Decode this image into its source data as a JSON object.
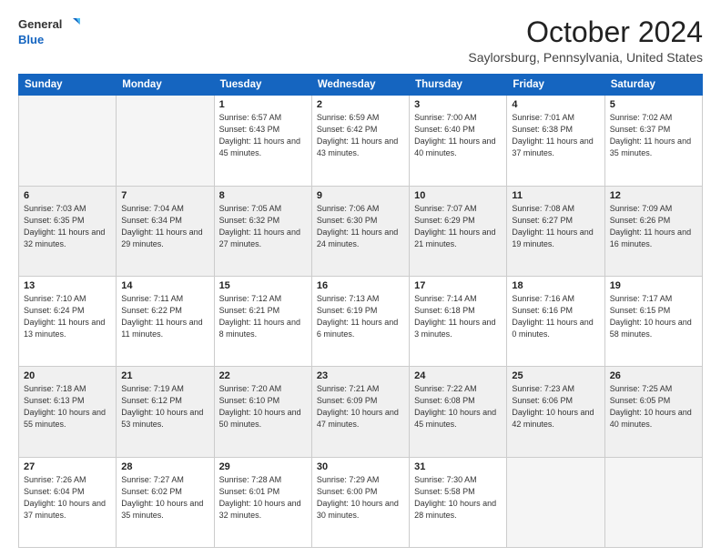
{
  "header": {
    "logo": {
      "line1": "General",
      "line2": "Blue"
    },
    "title": "October 2024",
    "location": "Saylorsburg, Pennsylvania, United States"
  },
  "weekdays": [
    "Sunday",
    "Monday",
    "Tuesday",
    "Wednesday",
    "Thursday",
    "Friday",
    "Saturday"
  ],
  "weeks": [
    [
      {
        "day": "",
        "empty": true
      },
      {
        "day": "",
        "empty": true
      },
      {
        "day": "1",
        "sunrise": "Sunrise: 6:57 AM",
        "sunset": "Sunset: 6:43 PM",
        "daylight": "Daylight: 11 hours and 45 minutes."
      },
      {
        "day": "2",
        "sunrise": "Sunrise: 6:59 AM",
        "sunset": "Sunset: 6:42 PM",
        "daylight": "Daylight: 11 hours and 43 minutes."
      },
      {
        "day": "3",
        "sunrise": "Sunrise: 7:00 AM",
        "sunset": "Sunset: 6:40 PM",
        "daylight": "Daylight: 11 hours and 40 minutes."
      },
      {
        "day": "4",
        "sunrise": "Sunrise: 7:01 AM",
        "sunset": "Sunset: 6:38 PM",
        "daylight": "Daylight: 11 hours and 37 minutes."
      },
      {
        "day": "5",
        "sunrise": "Sunrise: 7:02 AM",
        "sunset": "Sunset: 6:37 PM",
        "daylight": "Daylight: 11 hours and 35 minutes."
      }
    ],
    [
      {
        "day": "6",
        "sunrise": "Sunrise: 7:03 AM",
        "sunset": "Sunset: 6:35 PM",
        "daylight": "Daylight: 11 hours and 32 minutes."
      },
      {
        "day": "7",
        "sunrise": "Sunrise: 7:04 AM",
        "sunset": "Sunset: 6:34 PM",
        "daylight": "Daylight: 11 hours and 29 minutes."
      },
      {
        "day": "8",
        "sunrise": "Sunrise: 7:05 AM",
        "sunset": "Sunset: 6:32 PM",
        "daylight": "Daylight: 11 hours and 27 minutes."
      },
      {
        "day": "9",
        "sunrise": "Sunrise: 7:06 AM",
        "sunset": "Sunset: 6:30 PM",
        "daylight": "Daylight: 11 hours and 24 minutes."
      },
      {
        "day": "10",
        "sunrise": "Sunrise: 7:07 AM",
        "sunset": "Sunset: 6:29 PM",
        "daylight": "Daylight: 11 hours and 21 minutes."
      },
      {
        "day": "11",
        "sunrise": "Sunrise: 7:08 AM",
        "sunset": "Sunset: 6:27 PM",
        "daylight": "Daylight: 11 hours and 19 minutes."
      },
      {
        "day": "12",
        "sunrise": "Sunrise: 7:09 AM",
        "sunset": "Sunset: 6:26 PM",
        "daylight": "Daylight: 11 hours and 16 minutes."
      }
    ],
    [
      {
        "day": "13",
        "sunrise": "Sunrise: 7:10 AM",
        "sunset": "Sunset: 6:24 PM",
        "daylight": "Daylight: 11 hours and 13 minutes."
      },
      {
        "day": "14",
        "sunrise": "Sunrise: 7:11 AM",
        "sunset": "Sunset: 6:22 PM",
        "daylight": "Daylight: 11 hours and 11 minutes."
      },
      {
        "day": "15",
        "sunrise": "Sunrise: 7:12 AM",
        "sunset": "Sunset: 6:21 PM",
        "daylight": "Daylight: 11 hours and 8 minutes."
      },
      {
        "day": "16",
        "sunrise": "Sunrise: 7:13 AM",
        "sunset": "Sunset: 6:19 PM",
        "daylight": "Daylight: 11 hours and 6 minutes."
      },
      {
        "day": "17",
        "sunrise": "Sunrise: 7:14 AM",
        "sunset": "Sunset: 6:18 PM",
        "daylight": "Daylight: 11 hours and 3 minutes."
      },
      {
        "day": "18",
        "sunrise": "Sunrise: 7:16 AM",
        "sunset": "Sunset: 6:16 PM",
        "daylight": "Daylight: 11 hours and 0 minutes."
      },
      {
        "day": "19",
        "sunrise": "Sunrise: 7:17 AM",
        "sunset": "Sunset: 6:15 PM",
        "daylight": "Daylight: 10 hours and 58 minutes."
      }
    ],
    [
      {
        "day": "20",
        "sunrise": "Sunrise: 7:18 AM",
        "sunset": "Sunset: 6:13 PM",
        "daylight": "Daylight: 10 hours and 55 minutes."
      },
      {
        "day": "21",
        "sunrise": "Sunrise: 7:19 AM",
        "sunset": "Sunset: 6:12 PM",
        "daylight": "Daylight: 10 hours and 53 minutes."
      },
      {
        "day": "22",
        "sunrise": "Sunrise: 7:20 AM",
        "sunset": "Sunset: 6:10 PM",
        "daylight": "Daylight: 10 hours and 50 minutes."
      },
      {
        "day": "23",
        "sunrise": "Sunrise: 7:21 AM",
        "sunset": "Sunset: 6:09 PM",
        "daylight": "Daylight: 10 hours and 47 minutes."
      },
      {
        "day": "24",
        "sunrise": "Sunrise: 7:22 AM",
        "sunset": "Sunset: 6:08 PM",
        "daylight": "Daylight: 10 hours and 45 minutes."
      },
      {
        "day": "25",
        "sunrise": "Sunrise: 7:23 AM",
        "sunset": "Sunset: 6:06 PM",
        "daylight": "Daylight: 10 hours and 42 minutes."
      },
      {
        "day": "26",
        "sunrise": "Sunrise: 7:25 AM",
        "sunset": "Sunset: 6:05 PM",
        "daylight": "Daylight: 10 hours and 40 minutes."
      }
    ],
    [
      {
        "day": "27",
        "sunrise": "Sunrise: 7:26 AM",
        "sunset": "Sunset: 6:04 PM",
        "daylight": "Daylight: 10 hours and 37 minutes."
      },
      {
        "day": "28",
        "sunrise": "Sunrise: 7:27 AM",
        "sunset": "Sunset: 6:02 PM",
        "daylight": "Daylight: 10 hours and 35 minutes."
      },
      {
        "day": "29",
        "sunrise": "Sunrise: 7:28 AM",
        "sunset": "Sunset: 6:01 PM",
        "daylight": "Daylight: 10 hours and 32 minutes."
      },
      {
        "day": "30",
        "sunrise": "Sunrise: 7:29 AM",
        "sunset": "Sunset: 6:00 PM",
        "daylight": "Daylight: 10 hours and 30 minutes."
      },
      {
        "day": "31",
        "sunrise": "Sunrise: 7:30 AM",
        "sunset": "Sunset: 5:58 PM",
        "daylight": "Daylight: 10 hours and 28 minutes."
      },
      {
        "day": "",
        "empty": true
      },
      {
        "day": "",
        "empty": true
      }
    ]
  ]
}
